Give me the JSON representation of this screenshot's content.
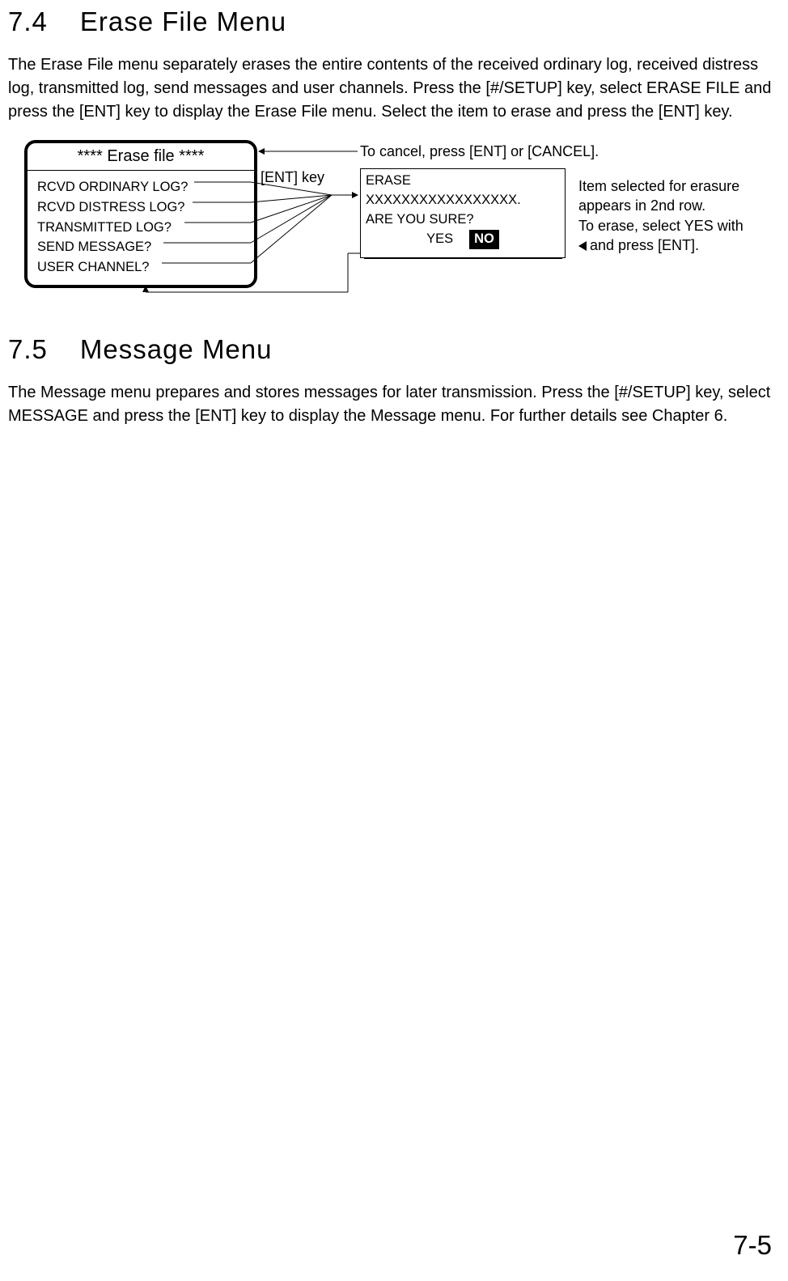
{
  "section74": {
    "num": "7.4",
    "title": "Erase File Menu",
    "body": "The Erase File menu separately erases the entire contents of the received ordinary log, received distress log, transmitted log, send messages and user channels. Press the [#/SETUP] key, select ERASE FILE and press the [ENT] key to display the Erase File menu. Select the item to erase and press the [ENT] key."
  },
  "diagram": {
    "erase_title": "**** Erase file ****",
    "items": [
      "RCVD ORDINARY LOG?",
      "RCVD DISTRESS LOG?",
      "TRANSMITTED LOG?",
      "SEND MESSAGE?",
      "USER CHANNEL?"
    ],
    "ent_key": "[ENT] key",
    "confirm": {
      "line1": "ERASE",
      "line2": "XXXXXXXXXXXXXXXXX.",
      "line3": "ARE YOU SURE?",
      "yes": "YES",
      "no": "NO"
    },
    "cancel_text": "To cancel, press [ENT] or [CANCEL].",
    "side": {
      "line1": "Item selected for erasure appears in 2nd row.",
      "line2": "To erase, select YES with",
      "line3": "and press [ENT]."
    }
  },
  "section75": {
    "num": "7.5",
    "title": "Message Menu",
    "body": "The Message menu prepares and stores messages for later transmission. Press the [#/SETUP] key, select MESSAGE and press the [ENT] key to display the Message menu. For further details see Chapter 6."
  },
  "page_number": "7-5"
}
